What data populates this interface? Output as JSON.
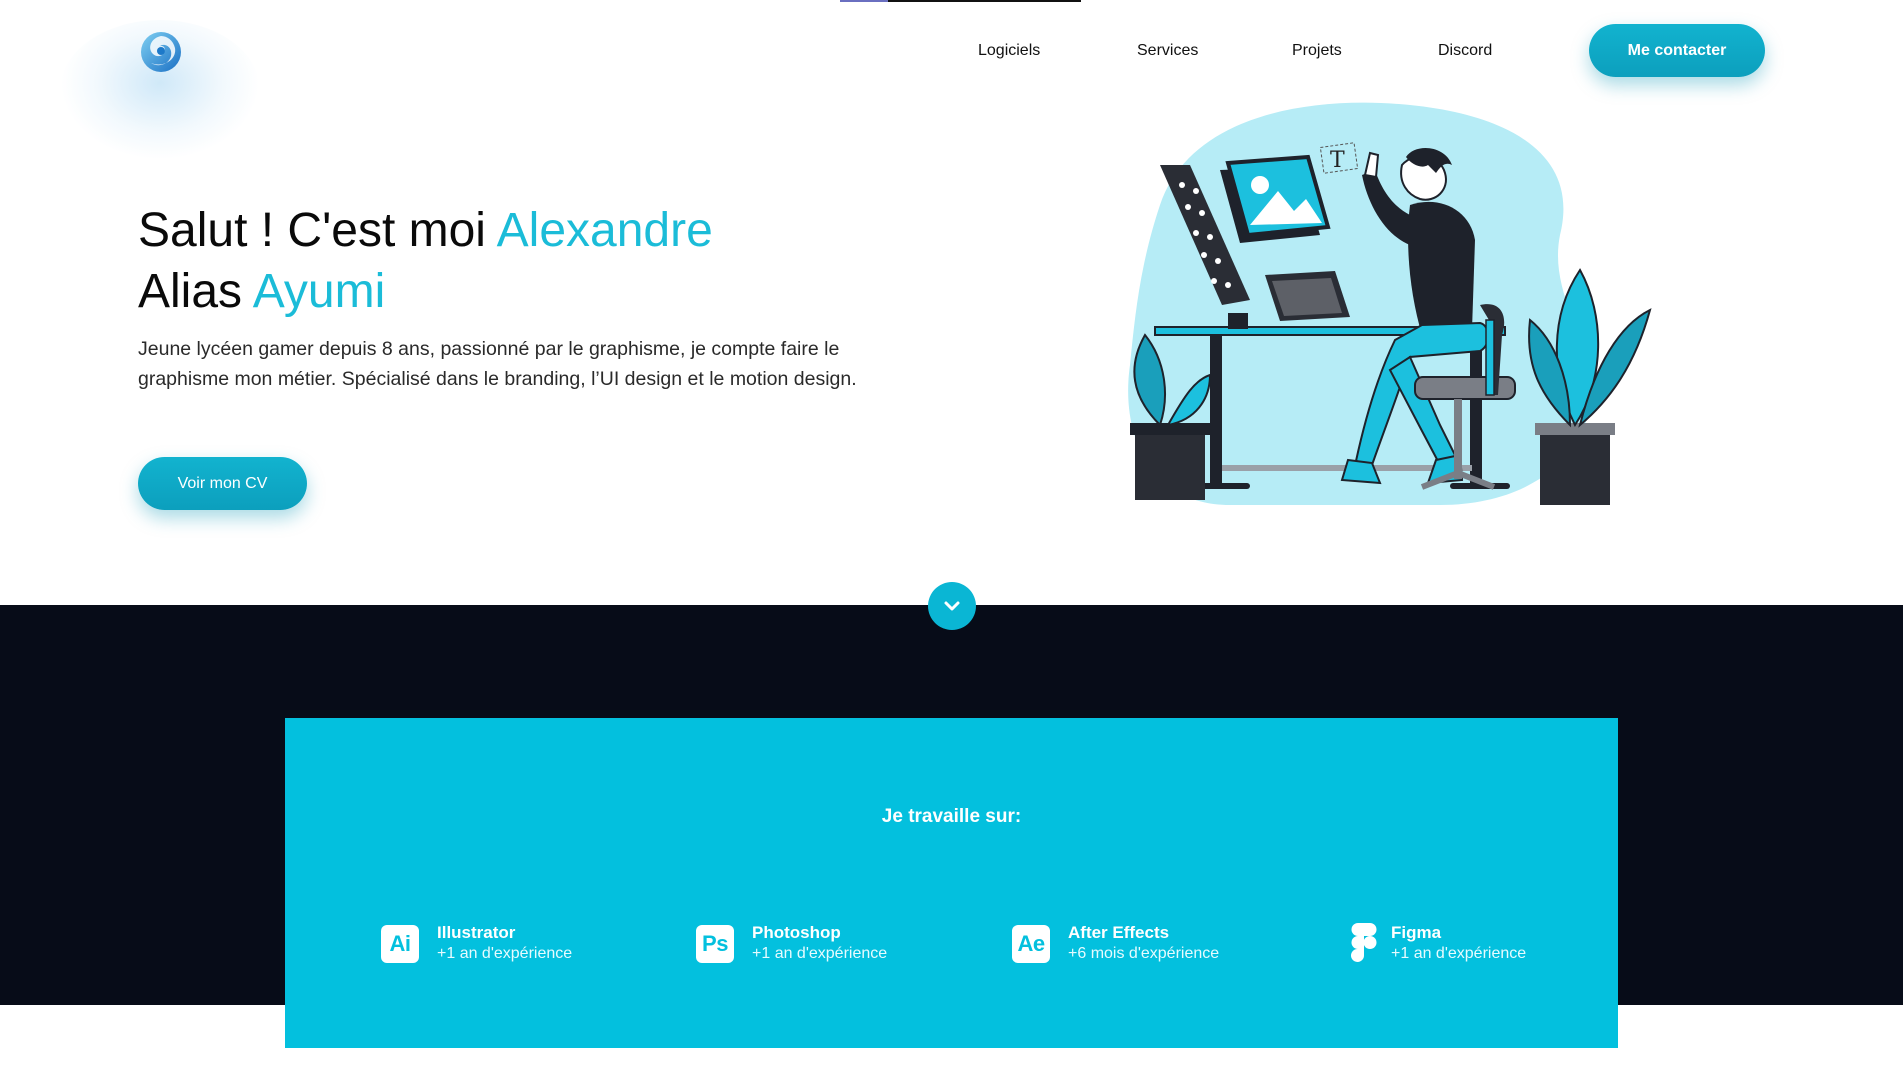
{
  "nav": {
    "items": [
      {
        "label": "Logiciels"
      },
      {
        "label": "Services"
      },
      {
        "label": "Projets"
      },
      {
        "label": "Discord"
      }
    ],
    "contact_label": "Me contacter"
  },
  "hero": {
    "title_line1_prefix": "Salut ! C'est moi ",
    "title_line1_name": "Alexandre",
    "title_line2_prefix": "Alias ",
    "title_line2_alias": "Ayumi",
    "description": "Jeune lycéen gamer depuis 8 ans, passionné par le graphisme, je compte faire le graphisme mon métier. Spécialisé dans le branding, l’UI design et le motion design.",
    "cv_button": "Voir mon CV"
  },
  "tools": {
    "title": "Je travaille sur:",
    "items": [
      {
        "icon": "Ai",
        "name": "Illustrator",
        "experience": "+1 an d'expérience"
      },
      {
        "icon": "Ps",
        "name": "Photoshop",
        "experience": "+1 an d'expérience"
      },
      {
        "icon": "Ae",
        "name": "After Effects",
        "experience": "+6 mois d'expérience"
      },
      {
        "icon": "figma-icon",
        "name": "Figma",
        "experience": "+1 an d'expérience"
      }
    ]
  },
  "colors": {
    "accent": "#1bbcd8",
    "button": "#0ea8c6",
    "dark_band": "#070c18",
    "panel": "#03c0de"
  }
}
